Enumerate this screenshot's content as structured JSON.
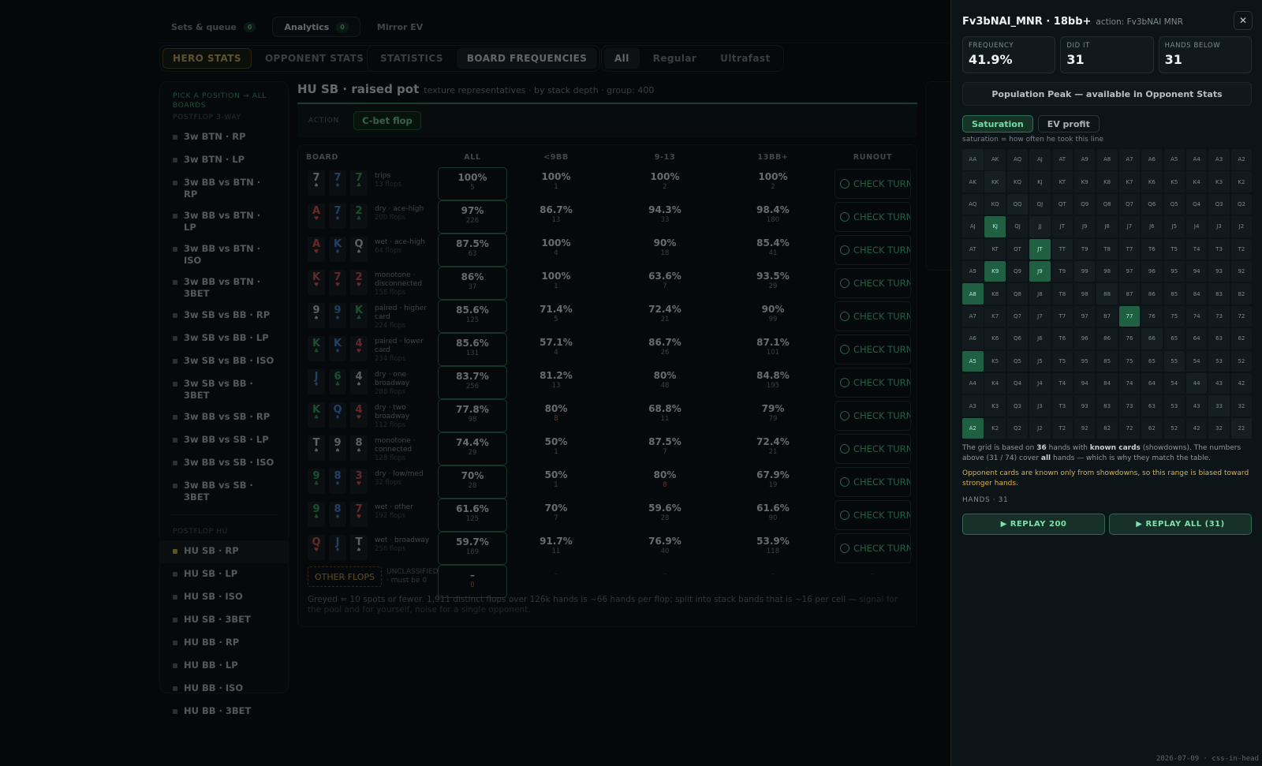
{
  "nav": {
    "tabs": [
      {
        "label": "Sets & queue",
        "badge": "0"
      },
      {
        "label": "Analytics",
        "badge": "0"
      },
      {
        "label": "Mirror EV",
        "badge": ""
      }
    ]
  },
  "stat_tabs": [
    "HERO STATS",
    "OPPONENT STATS"
  ],
  "view_tabs": [
    "STATISTICS",
    "BOARD FREQUENCIES"
  ],
  "speed_tabs": [
    "All",
    "Regular",
    "Ultrafast"
  ],
  "sidebar": {
    "heading": "PICK A POSITION → ALL BOARDS",
    "section1": "POSTFLOP 3-WAY",
    "items3": [
      "3w BTN · RP",
      "3w BTN · LP",
      "3w BB vs BTN · RP",
      "3w BB vs BTN · LP",
      "3w BB vs BTN · ISO",
      "3w BB vs BTN · 3BET",
      "3w SB vs BB · RP",
      "3w SB vs BB · LP",
      "3w SB vs BB · ISO",
      "3w SB vs BB · 3BET",
      "3w BB vs SB · RP",
      "3w BB vs SB · LP",
      "3w BB vs SB · ISO",
      "3w BB vs SB · 3BET"
    ],
    "section2": "POSTFLOP HU",
    "itemsHU": [
      "HU SB · RP",
      "HU SB · LP",
      "HU SB · ISO",
      "HU SB · 3BET",
      "HU BB · RP",
      "HU BB · LP",
      "HU BB · ISO",
      "HU BB · 3BET"
    ]
  },
  "main": {
    "title": "HU SB · raised pot",
    "subtitle": "texture representatives · by stack depth · group: 400",
    "action_label": "ACTION",
    "action_value": "C-bet flop",
    "headers": [
      "BOARD",
      "ALL",
      "<9BB",
      "9-13",
      "13BB+",
      "RUNOUT"
    ],
    "rows": [
      {
        "cards": [
          [
            "7",
            "s"
          ],
          [
            "7",
            "d"
          ],
          [
            "7",
            "c"
          ]
        ],
        "texture": "trips",
        "flops": "13 flops",
        "all": [
          "100%",
          "5"
        ],
        "b1": [
          "100%",
          "1"
        ],
        "b2": [
          "100%",
          "2"
        ],
        "b3": [
          "100%",
          "2"
        ],
        "runout": "CHECK TURN"
      },
      {
        "cards": [
          [
            "A",
            "h"
          ],
          [
            "7",
            "d"
          ],
          [
            "2",
            "c"
          ]
        ],
        "texture": "dry · ace-high",
        "flops": "200 flops",
        "all": [
          "97%",
          "226"
        ],
        "b1": [
          "86.7%",
          "13"
        ],
        "b2": [
          "94.3%",
          "33"
        ],
        "b3": [
          "98.4%",
          "180"
        ],
        "runout": "CHECK TURN"
      },
      {
        "cards": [
          [
            "A",
            "h"
          ],
          [
            "K",
            "d"
          ],
          [
            "Q",
            "s"
          ]
        ],
        "texture": "wet · ace-high",
        "flops": "64 flops",
        "all": [
          "87.5%",
          "63"
        ],
        "b1": [
          "100%",
          "4"
        ],
        "b2": [
          "90%",
          "18"
        ],
        "b3": [
          "85.4%",
          "41"
        ],
        "runout": "CHECK TURN"
      },
      {
        "cards": [
          [
            "K",
            "h"
          ],
          [
            "7",
            "h"
          ],
          [
            "2",
            "h"
          ]
        ],
        "texture": "monotone · disconnected",
        "flops": "158 flops",
        "all": [
          "86%",
          "37"
        ],
        "b1": [
          "100%",
          "1"
        ],
        "b2": [
          "63.6%",
          "7"
        ],
        "b3": [
          "93.5%",
          "29"
        ],
        "runout": "CHECK TURN"
      },
      {
        "cards": [
          [
            "9",
            "s"
          ],
          [
            "9",
            "d"
          ],
          [
            "K",
            "c"
          ]
        ],
        "texture": "paired · higher card",
        "flops": "224 flops",
        "all": [
          "85.6%",
          "125"
        ],
        "b1": [
          "71.4%",
          "5"
        ],
        "b2": [
          "72.4%",
          "21"
        ],
        "b3": [
          "90%",
          "99"
        ],
        "runout": "CHECK TURN"
      },
      {
        "cards": [
          [
            "K",
            "c"
          ],
          [
            "K",
            "d"
          ],
          [
            "4",
            "h"
          ]
        ],
        "texture": "paired · lower card",
        "flops": "234 flops",
        "all": [
          "85.6%",
          "131"
        ],
        "b1": [
          "57.1%",
          "4"
        ],
        "b2": [
          "86.7%",
          "26"
        ],
        "b3": [
          "87.1%",
          "101"
        ],
        "runout": "CHECK TURN"
      },
      {
        "cards": [
          [
            "J",
            "d"
          ],
          [
            "6",
            "c"
          ],
          [
            "4",
            "s"
          ]
        ],
        "texture": "dry · one broadway",
        "flops": "288 flops",
        "all": [
          "83.7%",
          "256"
        ],
        "b1": [
          "81.2%",
          "13"
        ],
        "b2": [
          "80%",
          "48"
        ],
        "b3": [
          "84.8%",
          "195"
        ],
        "runout": "CHECK TURN"
      },
      {
        "cards": [
          [
            "K",
            "c"
          ],
          [
            "Q",
            "d"
          ],
          [
            "4",
            "h"
          ]
        ],
        "texture": "dry · two broadway",
        "flops": "112 flops",
        "all": [
          "77.8%",
          "98"
        ],
        "b1": [
          "80%",
          "8"
        ],
        "b2": [
          "68.8%",
          "11"
        ],
        "b3": [
          "79%",
          "79"
        ],
        "runout": "CHECK TURN"
      },
      {
        "cards": [
          [
            "T",
            "s"
          ],
          [
            "9",
            "s"
          ],
          [
            "8",
            "s"
          ]
        ],
        "texture": "monotone · connected",
        "flops": "128 flops",
        "all": [
          "74.4%",
          "29"
        ],
        "b1": [
          "50%",
          "1"
        ],
        "b2": [
          "87.5%",
          "7"
        ],
        "b3": [
          "72.4%",
          "21"
        ],
        "runout": "CHECK TURN"
      },
      {
        "cards": [
          [
            "9",
            "c"
          ],
          [
            "8",
            "d"
          ],
          [
            "3",
            "h"
          ]
        ],
        "texture": "dry · low/med",
        "flops": "32 flops",
        "all": [
          "70%",
          "28"
        ],
        "b1": [
          "50%",
          "1"
        ],
        "b2": [
          "80%",
          "8"
        ],
        "b3": [
          "67.9%",
          "19"
        ],
        "runout": "CHECK TURN"
      },
      {
        "cards": [
          [
            "9",
            "c"
          ],
          [
            "8",
            "d"
          ],
          [
            "7",
            "h"
          ]
        ],
        "texture": "wet · other",
        "flops": "192 flops",
        "all": [
          "61.6%",
          "125"
        ],
        "b1": [
          "70%",
          "7"
        ],
        "b2": [
          "59.6%",
          "28"
        ],
        "b3": [
          "61.6%",
          "90"
        ],
        "runout": "CHECK TURN"
      },
      {
        "cards": [
          [
            "Q",
            "h"
          ],
          [
            "J",
            "d"
          ],
          [
            "T",
            "s"
          ]
        ],
        "texture": "wet · broadway",
        "flops": "256 flops",
        "all": [
          "59.7%",
          "169"
        ],
        "b1": [
          "91.7%",
          "11"
        ],
        "b2": [
          "76.9%",
          "40"
        ],
        "b3": [
          "53.9%",
          "118"
        ],
        "runout": "CHECK TURN"
      }
    ],
    "other": {
      "label": "OTHER FLOPS",
      "unclassified": "UNCLASSIFIED · must be 0",
      "all": [
        "–",
        "0"
      ],
      "dash": "–"
    },
    "footnote_main": "Greyed = 10 spots or fewer. 1,911 distinct flops over 126k hands is ~66 hands per flop; split into stack bands that is ~16 per cell —",
    "footnote_dim": "signal for the pool and for yourself, noise for a single opponent."
  },
  "panel": {
    "title": "Fv3bNAI_MNR · 18bb+",
    "action": "action: Fv3bNAI MNR",
    "stats": [
      {
        "label": "FREQUENCY",
        "value": "41.9%"
      },
      {
        "label": "DID IT",
        "value": "31"
      },
      {
        "label": "HANDS BELOW",
        "value": "31"
      }
    ],
    "peak": "Population Peak — available in Opponent Stats",
    "modes": [
      "Saturation",
      "EV profit"
    ],
    "saturation_note": "saturation = how often he took this line",
    "grid": [
      [
        "AA",
        "AK",
        "AQ",
        "AJ",
        "AT",
        "A9",
        "A8",
        "A7",
        "A6",
        "A5",
        "A4",
        "A3",
        "A2"
      ],
      [
        "AK",
        "KK",
        "KQ",
        "KJ",
        "KT",
        "K9",
        "K8",
        "K7",
        "K6",
        "K5",
        "K4",
        "K3",
        "K2"
      ],
      [
        "AQ",
        "KQ",
        "QQ",
        "QJ",
        "QT",
        "Q9",
        "Q8",
        "Q7",
        "Q6",
        "Q5",
        "Q4",
        "Q3",
        "Q2"
      ],
      [
        "AJ",
        "KJ",
        "QJ",
        "JJ",
        "JT",
        "J9",
        "J8",
        "J7",
        "J6",
        "J5",
        "J4",
        "J3",
        "J2"
      ],
      [
        "AT",
        "KT",
        "QT",
        "JT",
        "TT",
        "T9",
        "T8",
        "T7",
        "T6",
        "T5",
        "T4",
        "T3",
        "T2"
      ],
      [
        "A9",
        "K9",
        "Q9",
        "J9",
        "T9",
        "99",
        "98",
        "97",
        "96",
        "95",
        "94",
        "93",
        "92"
      ],
      [
        "A8",
        "K8",
        "Q8",
        "J8",
        "T8",
        "98",
        "88",
        "87",
        "86",
        "85",
        "84",
        "83",
        "82"
      ],
      [
        "A7",
        "K7",
        "Q7",
        "J7",
        "T7",
        "97",
        "87",
        "77",
        "76",
        "75",
        "74",
        "73",
        "72"
      ],
      [
        "A6",
        "K6",
        "Q6",
        "J6",
        "T6",
        "96",
        "86",
        "76",
        "66",
        "65",
        "64",
        "63",
        "62"
      ],
      [
        "A5",
        "K5",
        "Q5",
        "J5",
        "T5",
        "95",
        "85",
        "75",
        "65",
        "55",
        "54",
        "53",
        "52"
      ],
      [
        "A4",
        "K4",
        "Q4",
        "J4",
        "T4",
        "94",
        "84",
        "74",
        "64",
        "54",
        "44",
        "43",
        "42"
      ],
      [
        "A3",
        "K3",
        "Q3",
        "J3",
        "T3",
        "93",
        "83",
        "73",
        "63",
        "53",
        "43",
        "33",
        "32"
      ],
      [
        "A2",
        "K2",
        "Q2",
        "J2",
        "T2",
        "92",
        "82",
        "72",
        "62",
        "52",
        "42",
        "32",
        "22"
      ]
    ],
    "highlighted": [
      "3-1",
      "4-3",
      "5-1",
      "5-3",
      "6-0",
      "7-7",
      "9-0",
      "12-0"
    ],
    "note_1": "The grid is based on ",
    "note_b1": "36",
    "note_2": " hands with ",
    "note_b2": "known cards",
    "note_3": " (showdowns). The numbers above (31 / 74) cover ",
    "note_b3": "all",
    "note_4": " hands — which is why they match the table.",
    "warning": "Opponent cards are known only from showdowns, so this range is biased toward stronger hands.",
    "hands_label": "HANDS · 31",
    "replay_a": "▶ REPLAY 200",
    "replay_b": "▶ REPLAY ALL (31)"
  },
  "stamp": "2026-07-09 · css-in-head",
  "colors": {
    "accent": "#4fd195",
    "gold": "#cfb366",
    "panel_bg": "#0d1417",
    "highlight": "#1f6043"
  }
}
